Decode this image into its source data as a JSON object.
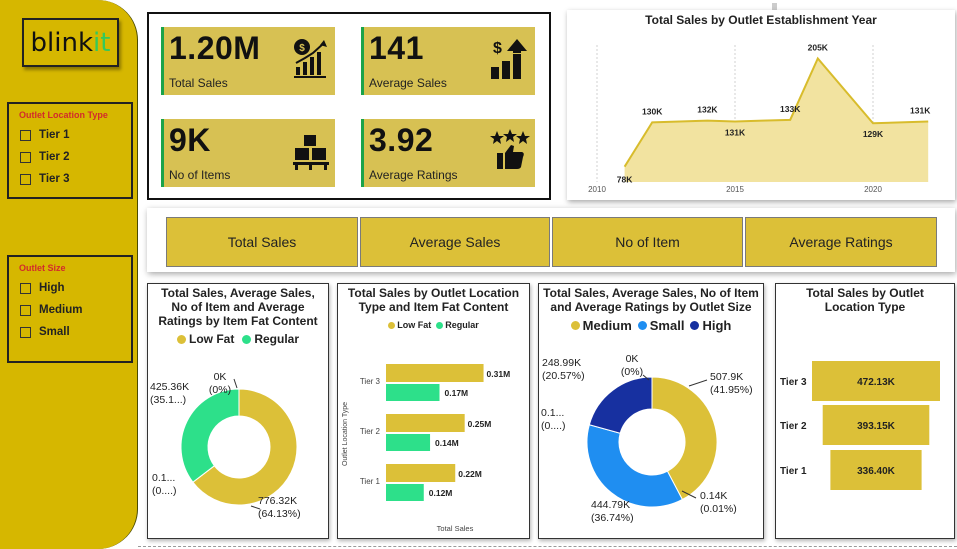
{
  "brand": {
    "name_part1": "blink",
    "name_part2": "it"
  },
  "slicers": {
    "location": {
      "title": "Outlet Location Type",
      "items": [
        "Tier 1",
        "Tier 2",
        "Tier 3"
      ]
    },
    "size": {
      "title": "Outlet Size",
      "items": [
        "High",
        "Medium",
        "Small"
      ]
    }
  },
  "kpis": [
    {
      "value": "1.20M",
      "label": "Total Sales",
      "icon": "money-bag-chart-icon"
    },
    {
      "value": "141",
      "label": "Average Sales",
      "icon": "dollar-bar-growth-icon"
    },
    {
      "value": "9K",
      "label": "No of Items",
      "icon": "boxes-pallet-icon"
    },
    {
      "value": "3.92",
      "label": "Average Ratings",
      "icon": "thumbs-up-stars-icon"
    }
  ],
  "buttons": [
    "Total Sales",
    "Average Sales",
    "No of Item",
    "Average Ratings"
  ],
  "colors": {
    "gold": "#dcc038",
    "green": "#2de08a",
    "blue": "#1f8ef1",
    "navy": "#1730a0",
    "accent_green": "#1aa34a",
    "sidebar": "#d6b700"
  },
  "chart_data": [
    {
      "type": "area",
      "title": "Total Sales by Outlet Establishment Year",
      "x": [
        2011,
        2012,
        2014,
        2015,
        2016,
        2017,
        2018,
        2020,
        2022
      ],
      "values": [
        78,
        130,
        132,
        131,
        132,
        133,
        205,
        129,
        131
      ],
      "labels": [
        "78K",
        "130K",
        "132K",
        "131K",
        "",
        "133K",
        "205K",
        "129K",
        "131K"
      ],
      "xticks": [
        "2010",
        "2015",
        "2020"
      ],
      "xlim": [
        2010,
        2022.5
      ],
      "ylim": [
        60,
        215
      ]
    },
    {
      "type": "pie",
      "title": "Total Sales, Average Sales, No of Item and Average Ratings by Item Fat Content",
      "legend": [
        "Low Fat",
        "Regular"
      ],
      "categories": [
        "Low Fat",
        "Regular",
        "",
        ""
      ],
      "values": [
        64.13,
        35.1,
        0.01,
        0.0
      ],
      "labels": [
        {
          "value": "776.32K",
          "pct": "(64.13%)"
        },
        {
          "value": "425.36K",
          "pct": "(35.1...)"
        },
        {
          "value": "0.1...",
          "pct": "(0....)"
        },
        {
          "value": "0K",
          "pct": "(0%)"
        }
      ]
    },
    {
      "type": "bar",
      "title": "Total Sales by Outlet Location Type and Item Fat Content",
      "legend": [
        "Low Fat",
        "Regular"
      ],
      "ylabel": "Outlet Location Type",
      "xlabel": "Total Sales",
      "categories": [
        "Tier 3",
        "Tier 2",
        "Tier 1"
      ],
      "series": [
        {
          "name": "Low Fat",
          "values": [
            0.31,
            0.25,
            0.22
          ],
          "labels": [
            "0.31M",
            "0.25M",
            "0.22M"
          ]
        },
        {
          "name": "Regular",
          "values": [
            0.17,
            0.14,
            0.12
          ],
          "labels": [
            "0.17M",
            "0.14M",
            "0.12M"
          ]
        }
      ],
      "xlim": [
        0,
        0.34
      ]
    },
    {
      "type": "pie",
      "title": "Total Sales, Average Sales, No of Item and Average Ratings by Outlet Size",
      "legend": [
        "Medium",
        "Small",
        "High"
      ],
      "categories": [
        "Medium",
        "",
        "Small",
        "",
        "High",
        ""
      ],
      "values": [
        41.95,
        0.01,
        36.74,
        0.0,
        20.57,
        0.0
      ],
      "labels": [
        {
          "value": "507.9K",
          "pct": "(41.95%)"
        },
        {
          "value": "0.14K",
          "pct": "(0.01%)"
        },
        {
          "value": "444.79K",
          "pct": "(36.74%)"
        },
        {
          "value": "0.1...",
          "pct": "(0....)"
        },
        {
          "value": "248.99K",
          "pct": "(20.57%)"
        },
        {
          "value": "0K",
          "pct": "(0%)"
        }
      ]
    },
    {
      "type": "bar",
      "title": "Total Sales by Outlet Location Type",
      "categories": [
        "Tier 3",
        "Tier 2",
        "Tier 1"
      ],
      "values": [
        472.13,
        393.15,
        336.4
      ],
      "labels": [
        "472.13K",
        "393.15K",
        "336.40K"
      ]
    }
  ]
}
